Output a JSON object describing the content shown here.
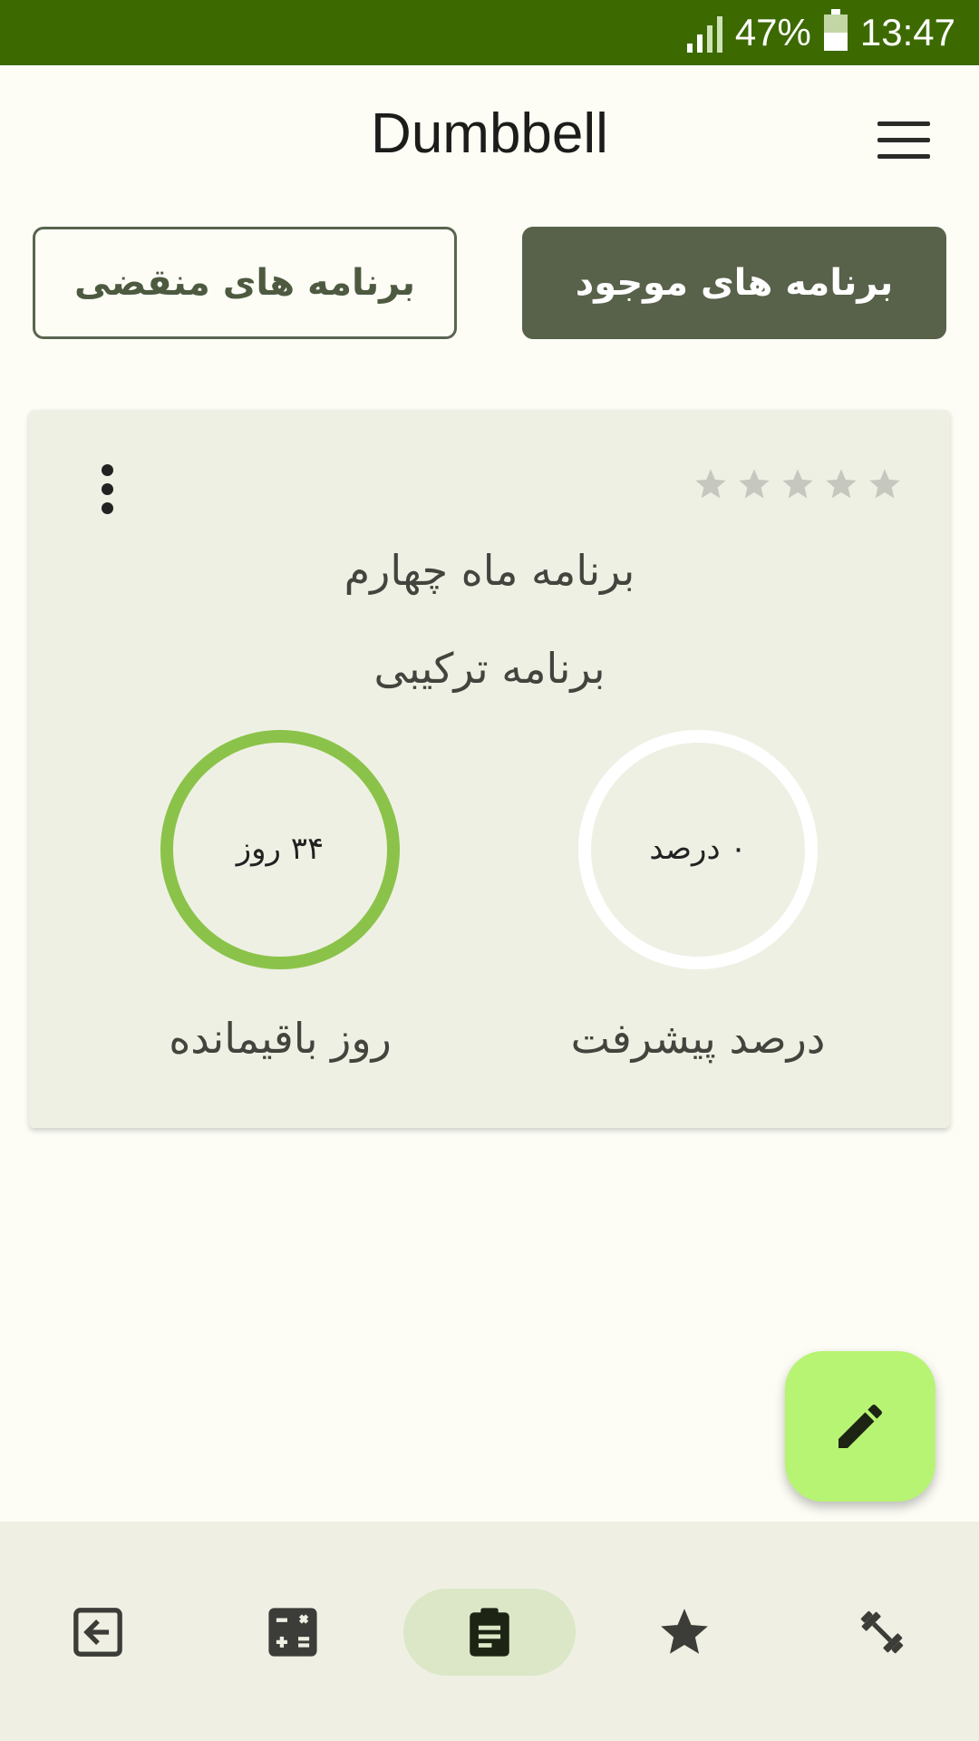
{
  "status": {
    "battery": "47%",
    "time": "13:47"
  },
  "header": {
    "title": "Dumbbell"
  },
  "tabs": {
    "active_label": "برنامه های موجود",
    "expired_label": "برنامه های منقضی"
  },
  "card": {
    "title": "برنامه ماه چهارم",
    "subtitle": "برنامه ترکیبی",
    "rating": 0,
    "rating_max": 5,
    "progress": {
      "value_text": "۰ درصد",
      "label": "درصد پیشرفت",
      "percent": 0
    },
    "remaining": {
      "value_text": "۳۴ روز",
      "label": "روز باقیمانده"
    }
  },
  "icons": {
    "menu": "menu-icon",
    "more": "more-vert-icon",
    "star": "star-icon",
    "fab": "edit-pencil-icon",
    "nav": [
      "exit-icon",
      "calculator-icon",
      "clipboard-icon",
      "star-icon",
      "dumbbell-icon"
    ]
  },
  "colors": {
    "status_bar": "#3c6a00",
    "tab_active": "#58624a",
    "progress_ring": "#ffffff",
    "remaining_ring": "#8bc34a",
    "fab": "#b8f474"
  }
}
